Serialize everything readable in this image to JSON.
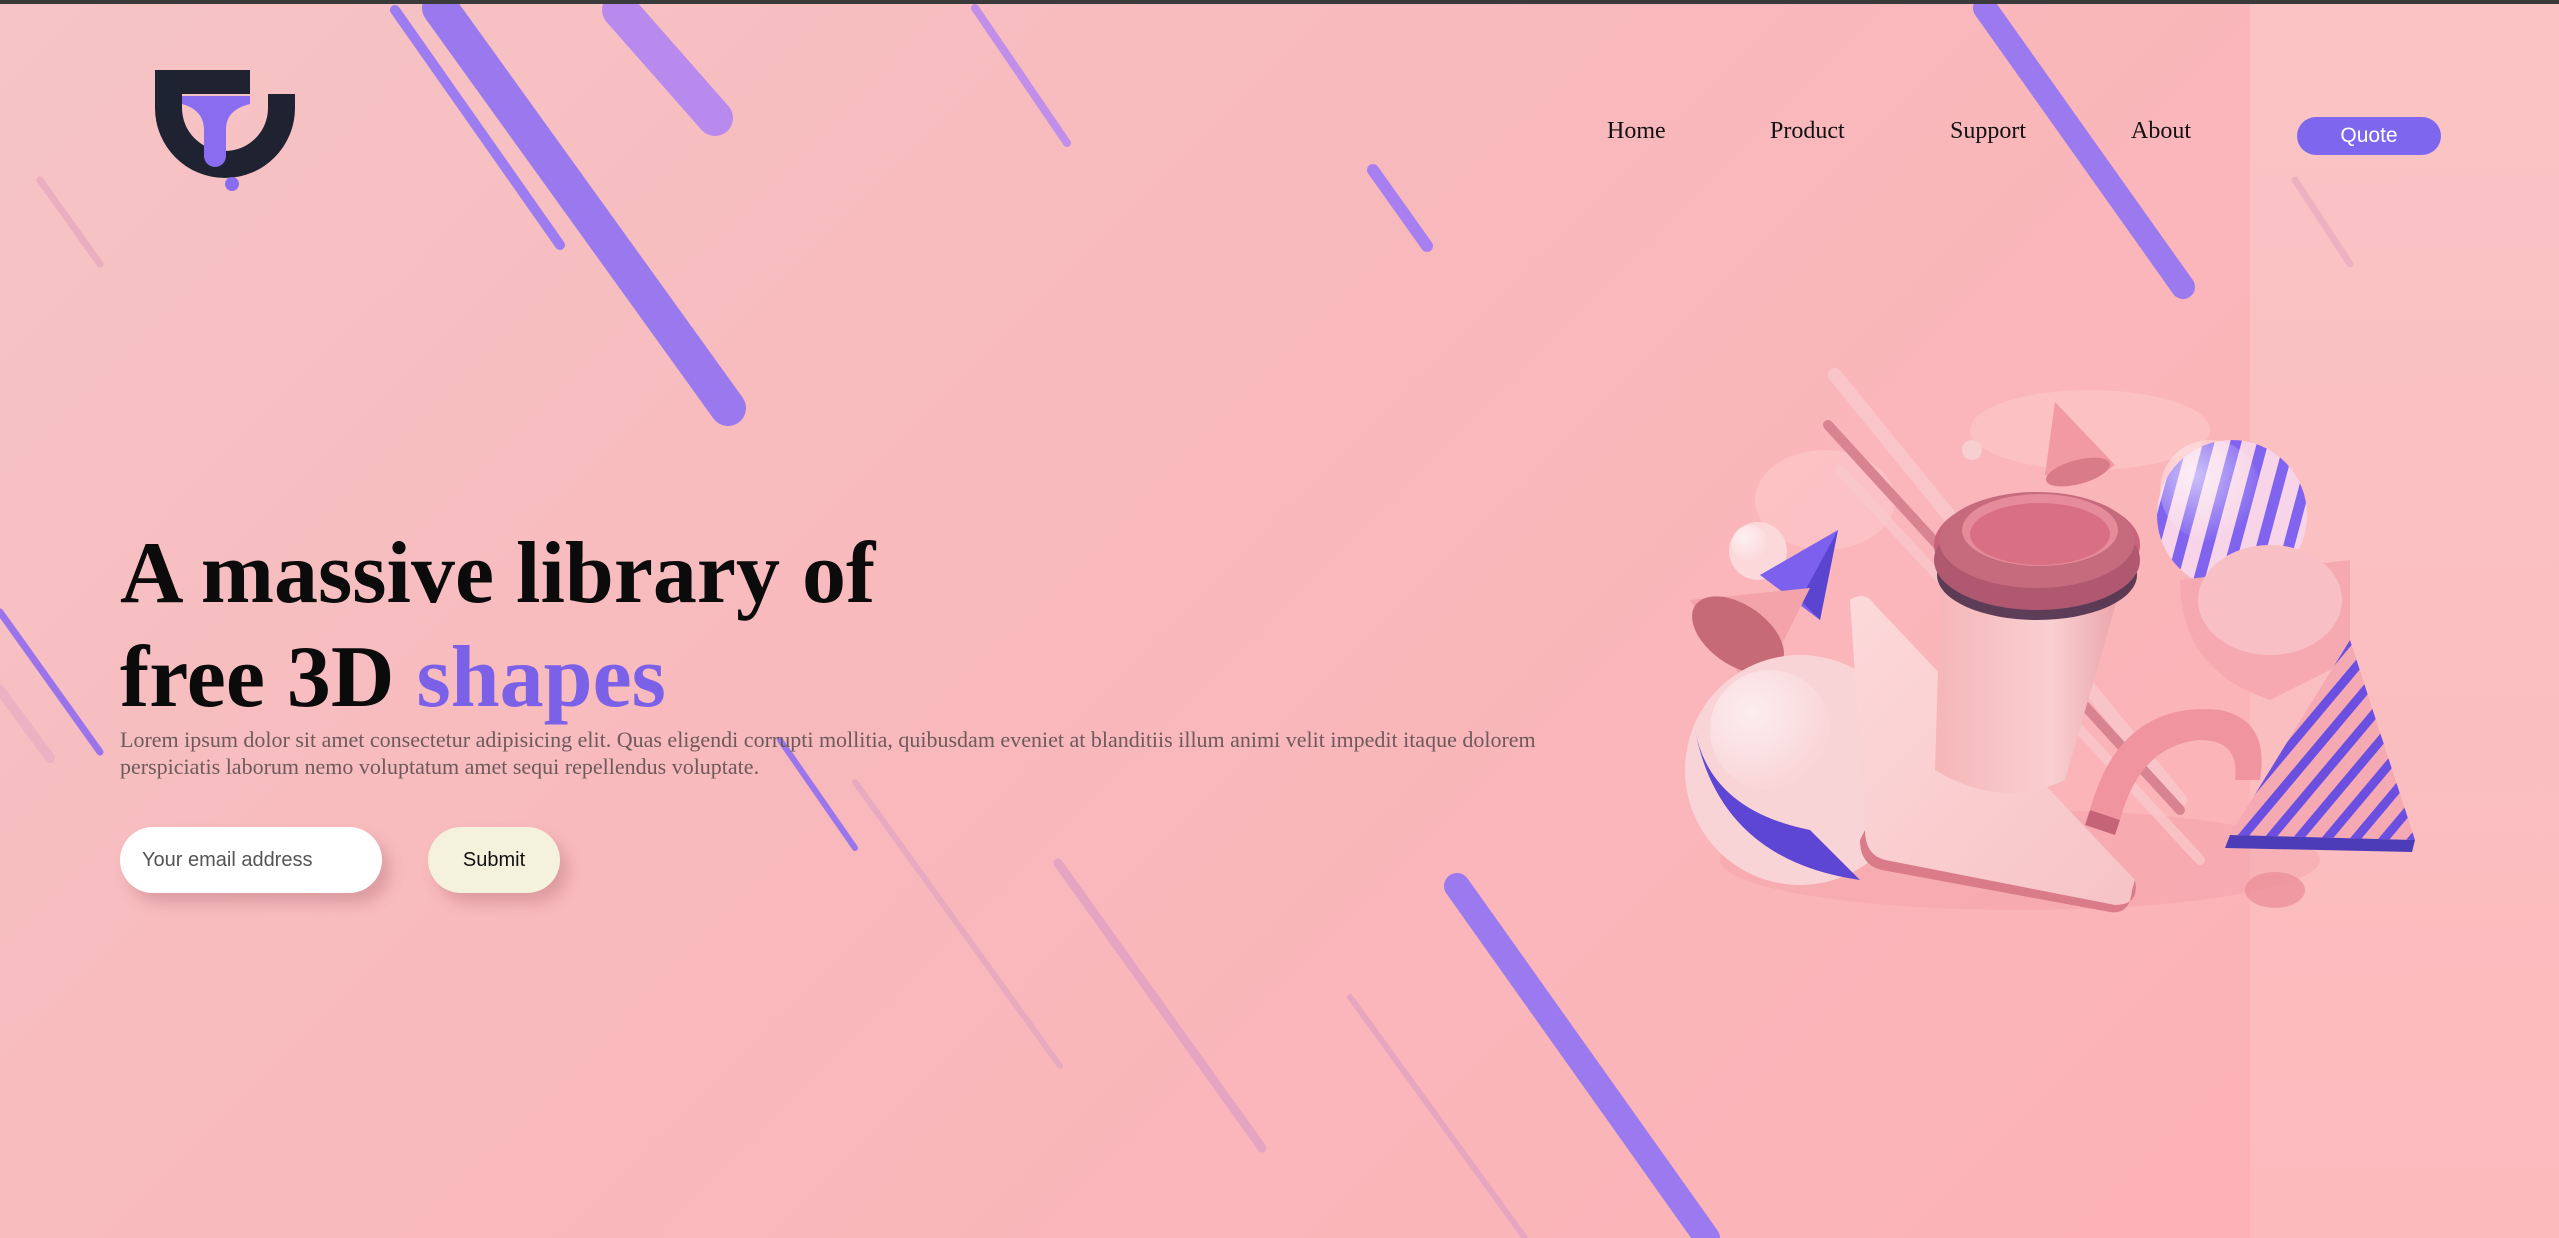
{
  "brand": {
    "logo_name": "logo"
  },
  "nav": {
    "items": [
      {
        "label": "Home"
      },
      {
        "label": "Product"
      },
      {
        "label": "Support"
      },
      {
        "label": "About"
      }
    ],
    "cta_label": "Quote"
  },
  "hero": {
    "headline_line1": "A massive library of",
    "headline_line2_plain": "free 3D ",
    "headline_line2_accent": "shapes",
    "description": "Lorem ipsum dolor sit amet consectetur adipisicing elit. Quas eligendi corrupti mollitia, quibusdam eveniet at blanditiis illum animi velit impedit itaque dolorem perspiciatis laborum nemo voluptatum amet sequi repellendus voluptate."
  },
  "form": {
    "email_placeholder": "Your email address",
    "email_value": "",
    "submit_label": "Submit"
  },
  "colors": {
    "accent": "#7b61e8",
    "background": "#f9b8bb",
    "submit_bg": "#f4f1dc",
    "logo_dark": "#1f2230"
  },
  "icons": [
    "logo-mark-icon",
    "shapes-illustration"
  ]
}
